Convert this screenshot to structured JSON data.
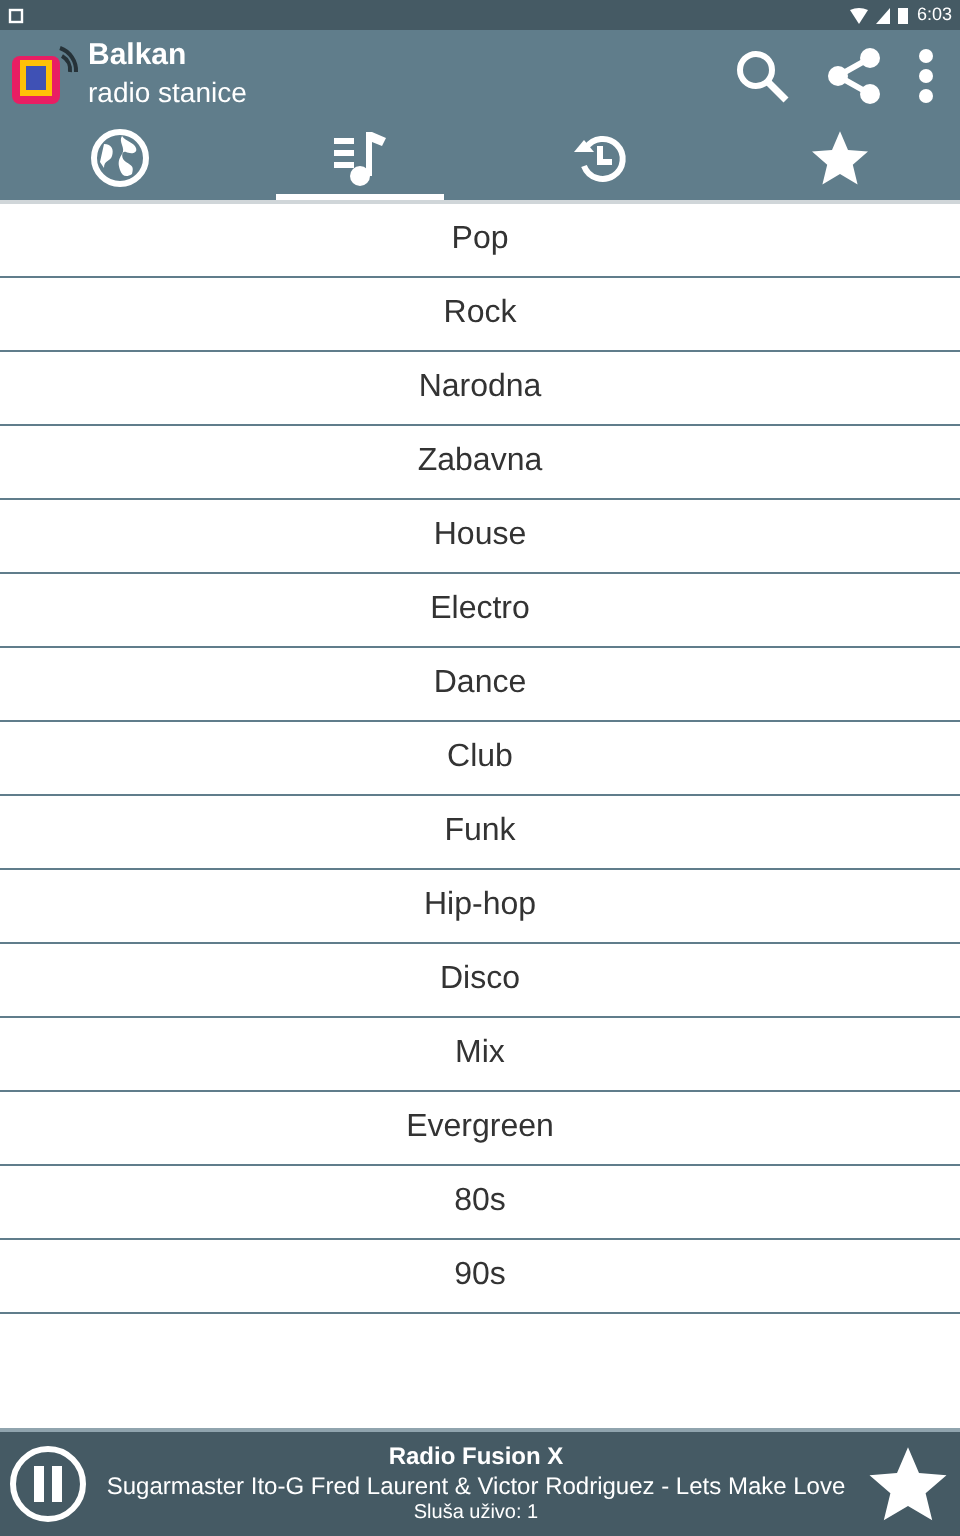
{
  "status_bar": {
    "time": "6:03"
  },
  "app_bar": {
    "title": "Balkan",
    "subtitle": "radio stanice"
  },
  "tabs": [
    {
      "kind": "globe",
      "selected": false
    },
    {
      "kind": "music",
      "selected": true
    },
    {
      "kind": "history",
      "selected": false
    },
    {
      "kind": "star",
      "selected": false
    }
  ],
  "genres": [
    "Pop",
    "Rock",
    "Narodna",
    "Zabavna",
    "House",
    "Electro",
    "Dance",
    "Club",
    "Funk",
    "Hip-hop",
    "Disco",
    "Mix",
    "Evergreen",
    "80s",
    "90s"
  ],
  "player": {
    "playing": true,
    "station": "Radio Fusion X",
    "track": "Sugarmaster Ito-G Fred Laurent & Victor Rodriguez - Lets Make Love",
    "listeners": "Sluša uživo: 1"
  }
}
